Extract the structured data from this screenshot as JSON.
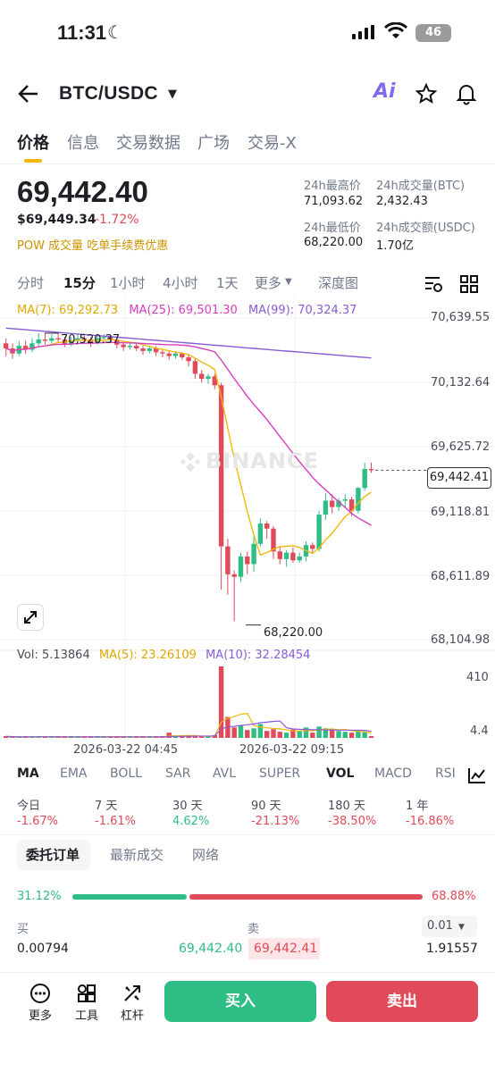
{
  "status": {
    "time": "11:31",
    "battery": "46"
  },
  "header": {
    "pair": "BTC/USDC",
    "ai_label": "Ai"
  },
  "tabs": [
    "价格",
    "信息",
    "交易数据",
    "广场",
    "交易-X"
  ],
  "ticker": {
    "last_price": "69,442.40",
    "usd_price": "$69,449.34",
    "change": "-1.72%",
    "promo": "POW  成交量  吃单手续费优惠",
    "high_label": "24h最高价",
    "high": "71,093.62",
    "vol_btc_label": "24h成交量(BTC)",
    "vol_btc": "2,432.43",
    "low_label": "24h最低价",
    "low": "68,220.00",
    "vol_usdc_label": "24h成交额(USDC)",
    "vol_usdc": "1.70亿"
  },
  "intervals": [
    "分时",
    "15分",
    "1小时",
    "4小时",
    "1天",
    "更多",
    "深度图"
  ],
  "ma": {
    "ma7": "MA(7): 69,292.73",
    "ma25": "MA(25): 69,501.30",
    "ma99": "MA(99): 70,324.37"
  },
  "axis": [
    "70,639.55",
    "70,132.64",
    "69,625.72",
    "69,118.81",
    "68,611.89",
    "68,104.98"
  ],
  "price_tag": "69,442.41",
  "high_mark": "70,520.37",
  "low_mark": "68,220.00",
  "watermark": "BINANCE",
  "volume": {
    "vol": "Vol: 5.13864",
    "ma5": "MA(5): 23.26109",
    "ma10": "MA(10): 32.28454",
    "axis_top": "410",
    "axis_bottom": "4.4"
  },
  "dates": [
    "2026-03-22 04:45",
    "2026-03-22 09:15"
  ],
  "indicators": [
    "MA",
    "EMA",
    "BOLL",
    "SAR",
    "AVL",
    "SUPER",
    "VOL",
    "MACD",
    "RSI"
  ],
  "performance": {
    "labels": [
      "今日",
      "7 天",
      "30 天",
      "90 天",
      "180 天",
      "1 年"
    ],
    "values": [
      "-1.67%",
      "-1.61%",
      "4.62%",
      "-21.13%",
      "-38.50%",
      "-16.86%"
    ]
  },
  "orderbook": {
    "tabs": [
      "委托订单",
      "最新成交",
      "网络"
    ],
    "buy_pct": "31.12%",
    "sell_pct": "68.88%",
    "buy_label": "买",
    "sell_label": "卖",
    "precision": "0.01",
    "row": {
      "bid_qty": "0.00794",
      "bid_price": "69,442.40",
      "ask_price": "69,442.41",
      "ask_qty": "1.91557"
    }
  },
  "bottom": {
    "more": "更多",
    "tools": "工具",
    "leverage": "杠杆",
    "buy": "买入",
    "sell": "卖出"
  },
  "colors": {
    "up": "#2ebd85",
    "down": "#e04a59",
    "ma7": "#f0b90b",
    "ma25": "#d63ebf",
    "ma99": "#8a5bd6"
  },
  "chart_data": {
    "type": "candlestick",
    "interval": "15分",
    "ylim": [
      68104.98,
      70639.55
    ],
    "candles": [
      [
        70440,
        70400,
        70480,
        70340
      ],
      [
        70400,
        70360,
        70440,
        70320
      ],
      [
        70360,
        70420,
        70460,
        70340
      ],
      [
        70420,
        70390,
        70460,
        70360
      ],
      [
        70390,
        70440,
        70480,
        70370
      ],
      [
        70440,
        70470,
        70520,
        70420
      ],
      [
        70470,
        70460,
        70520,
        70430
      ],
      [
        70460,
        70480,
        70510,
        70440
      ],
      [
        70480,
        70470,
        70520,
        70450
      ],
      [
        70470,
        70430,
        70490,
        70410
      ],
      [
        70430,
        70460,
        70490,
        70420
      ],
      [
        70460,
        70480,
        70510,
        70450
      ],
      [
        70480,
        70470,
        70500,
        70440
      ],
      [
        70470,
        70440,
        70490,
        70410
      ],
      [
        70440,
        70480,
        70500,
        70430
      ],
      [
        70480,
        70490,
        70510,
        70460
      ],
      [
        70490,
        70470,
        70510,
        70440
      ],
      [
        70470,
        70430,
        70490,
        70400
      ],
      [
        70430,
        70410,
        70450,
        70380
      ],
      [
        70410,
        70420,
        70440,
        70390
      ],
      [
        70420,
        70400,
        70440,
        70380
      ],
      [
        70400,
        70380,
        70420,
        70350
      ],
      [
        70380,
        70400,
        70420,
        70360
      ],
      [
        70400,
        70370,
        70420,
        70340
      ],
      [
        70370,
        70360,
        70390,
        70330
      ],
      [
        70360,
        70340,
        70380,
        70310
      ],
      [
        70340,
        70360,
        70380,
        70320
      ],
      [
        70360,
        70330,
        70370,
        70310
      ],
      [
        70330,
        70300,
        70350,
        70260
      ],
      [
        70300,
        70200,
        70320,
        70160
      ],
      [
        70200,
        70160,
        70230,
        70130
      ],
      [
        70160,
        70180,
        70200,
        70120
      ],
      [
        70180,
        70110,
        70200,
        70080
      ],
      [
        70110,
        68840,
        70130,
        68500
      ],
      [
        68840,
        68620,
        68900,
        68460
      ],
      [
        68620,
        68600,
        68650,
        68250
      ],
      [
        68600,
        68760,
        68790,
        68560
      ],
      [
        68760,
        68700,
        68800,
        68620
      ],
      [
        68700,
        68860,
        68920,
        68640
      ],
      [
        68860,
        69020,
        69060,
        68840
      ],
      [
        69020,
        68980,
        69040,
        68900
      ],
      [
        68980,
        68800,
        69000,
        68740
      ],
      [
        68800,
        68740,
        68840,
        68700
      ],
      [
        68740,
        68790,
        68810,
        68680
      ],
      [
        68790,
        68730,
        68830,
        68710
      ],
      [
        68730,
        68760,
        68790,
        68710
      ],
      [
        68760,
        68850,
        68880,
        68720
      ],
      [
        68850,
        68820,
        68870,
        68780
      ],
      [
        68820,
        69090,
        69120,
        68800
      ],
      [
        69090,
        69200,
        69260,
        69050
      ],
      [
        69200,
        69150,
        69250,
        69100
      ],
      [
        69150,
        69200,
        69220,
        69120
      ],
      [
        69200,
        69210,
        69250,
        69150
      ],
      [
        69210,
        69120,
        69230,
        69080
      ],
      [
        69120,
        69300,
        69310,
        69100
      ],
      [
        69300,
        69450,
        69500,
        69280
      ],
      [
        69450,
        69440,
        69500,
        69420
      ]
    ],
    "volumes": [
      8,
      6,
      5,
      7,
      6,
      9,
      7,
      6,
      5,
      6,
      7,
      5,
      6,
      6,
      8,
      7,
      6,
      5,
      6,
      7,
      5,
      6,
      6,
      5,
      7,
      30,
      12,
      10,
      8,
      9,
      10,
      7,
      16,
      410,
      120,
      60,
      70,
      45,
      55,
      80,
      40,
      50,
      35,
      30,
      48,
      38,
      60,
      30,
      65,
      55,
      45,
      40,
      35,
      30,
      38,
      32,
      8
    ]
  }
}
